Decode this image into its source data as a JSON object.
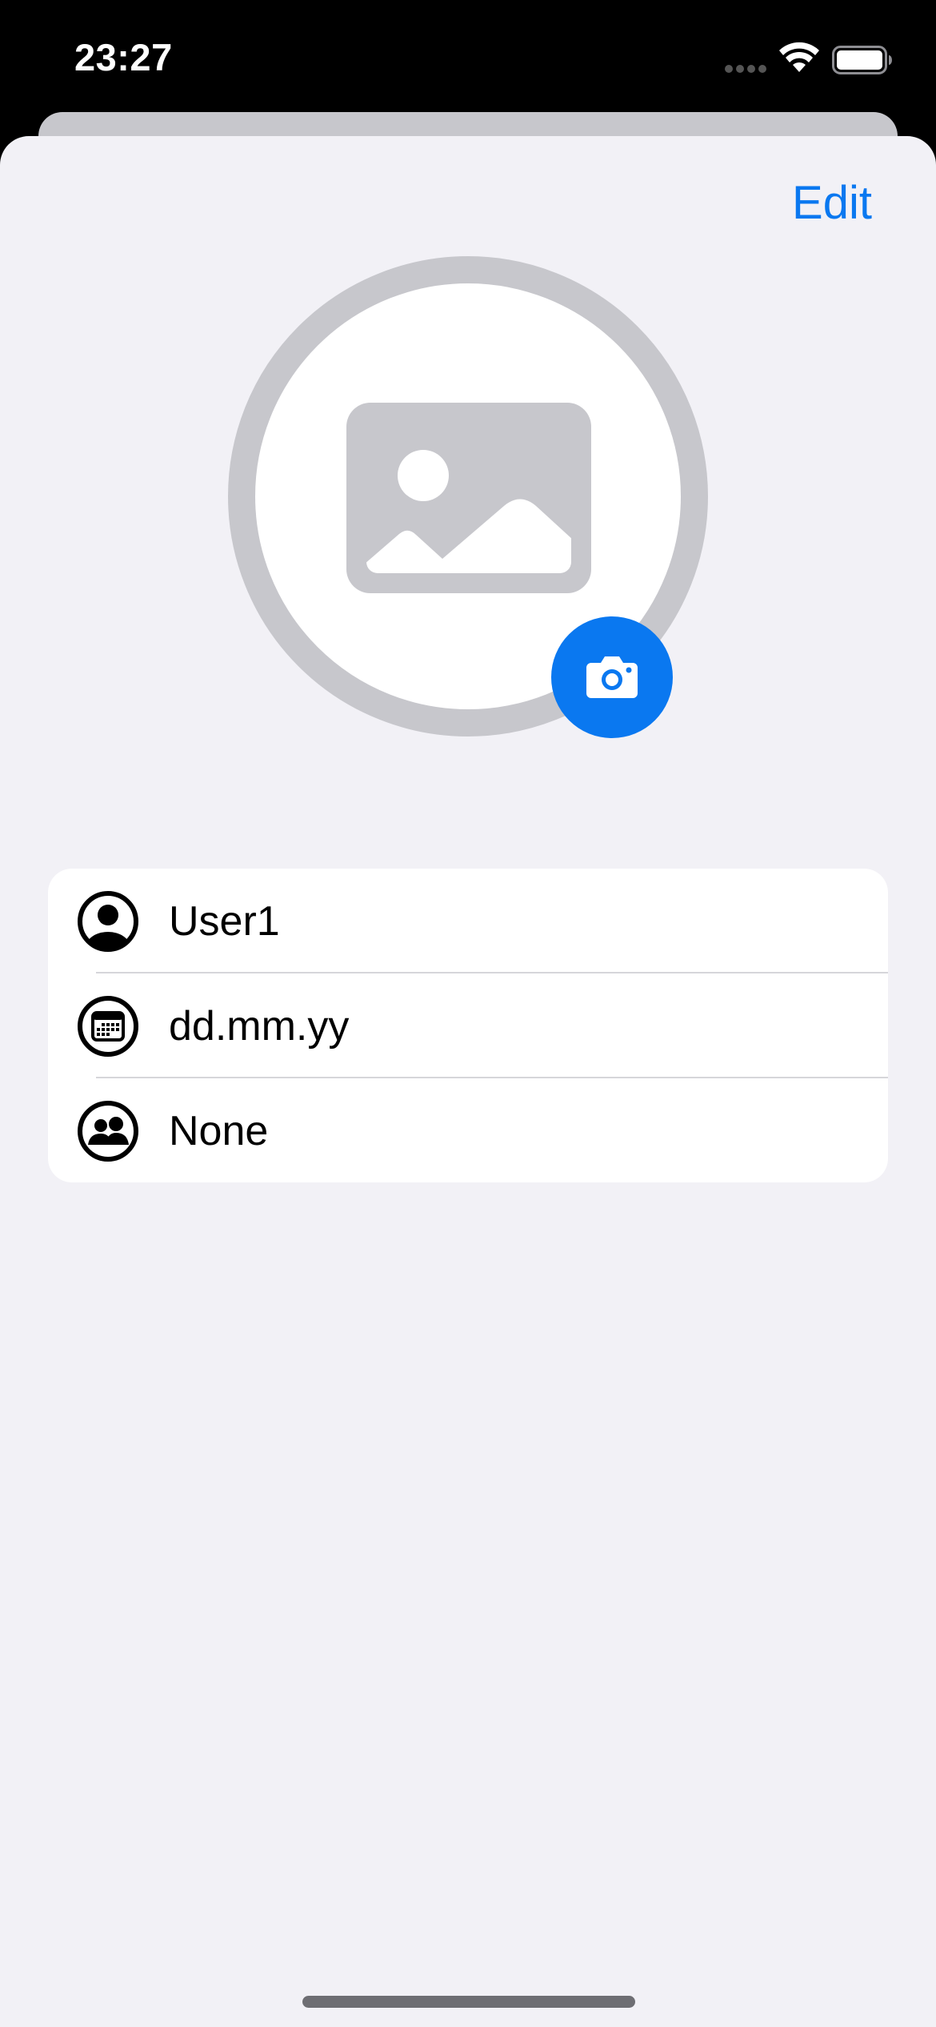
{
  "status_bar": {
    "time": "23:27"
  },
  "toolbar": {
    "edit_label": "Edit"
  },
  "profile": {
    "avatar_icon": "photo-placeholder-icon",
    "camera_icon": "camera-icon"
  },
  "info_rows": [
    {
      "icon": "person-circle-icon",
      "label": "User1"
    },
    {
      "icon": "calendar-circle-icon",
      "label": "dd.mm.yy"
    },
    {
      "icon": "group-circle-icon",
      "label": "None"
    }
  ],
  "colors": {
    "accent": "#0a78f0",
    "sheet_background": "#f2f1f6",
    "placeholder_gray": "#c7c7cc"
  }
}
